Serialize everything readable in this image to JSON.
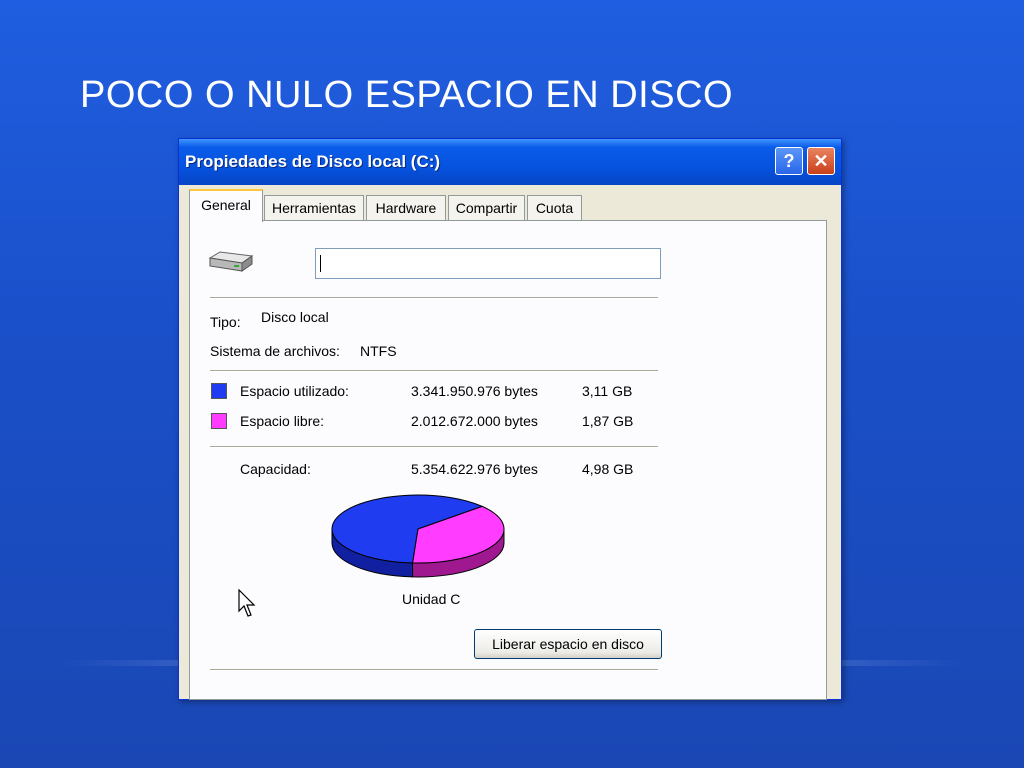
{
  "slide": {
    "title": "POCO O NULO ESPACIO EN DISCO"
  },
  "window": {
    "title": "Propiedades de Disco local (C:)",
    "help_label": "?",
    "close_label": "✕"
  },
  "tabs": [
    {
      "label": "General"
    },
    {
      "label": "Herramientas"
    },
    {
      "label": "Hardware"
    },
    {
      "label": "Compartir"
    },
    {
      "label": "Cuota"
    }
  ],
  "general": {
    "name_value": "",
    "tipo_label": "Tipo:",
    "tipo_value": "Disco local",
    "fs_label": "Sistema de archivos:",
    "fs_value": "NTFS",
    "used": {
      "label": "Espacio utilizado:",
      "bytes": "3.341.950.976 bytes",
      "size": "3,11 GB",
      "color": "#1f3cf0"
    },
    "free": {
      "label": "Espacio libre:",
      "bytes": "2.012.672.000 bytes",
      "size": "1,87 GB",
      "color": "#ff3cff"
    },
    "capacity": {
      "label": "Capacidad:",
      "bytes": "5.354.622.976 bytes",
      "size": "4,98 GB"
    },
    "drive_label": "Unidad C",
    "cleanup_button": "Liberar espacio en disco"
  },
  "chart_data": {
    "type": "pie",
    "categories": [
      "Espacio utilizado",
      "Espacio libre"
    ],
    "values": [
      3341950976,
      2012672000
    ],
    "colors": [
      "#1f3cf0",
      "#ff3cff"
    ],
    "side_colors": [
      "#1020a0",
      "#a01890"
    ]
  }
}
